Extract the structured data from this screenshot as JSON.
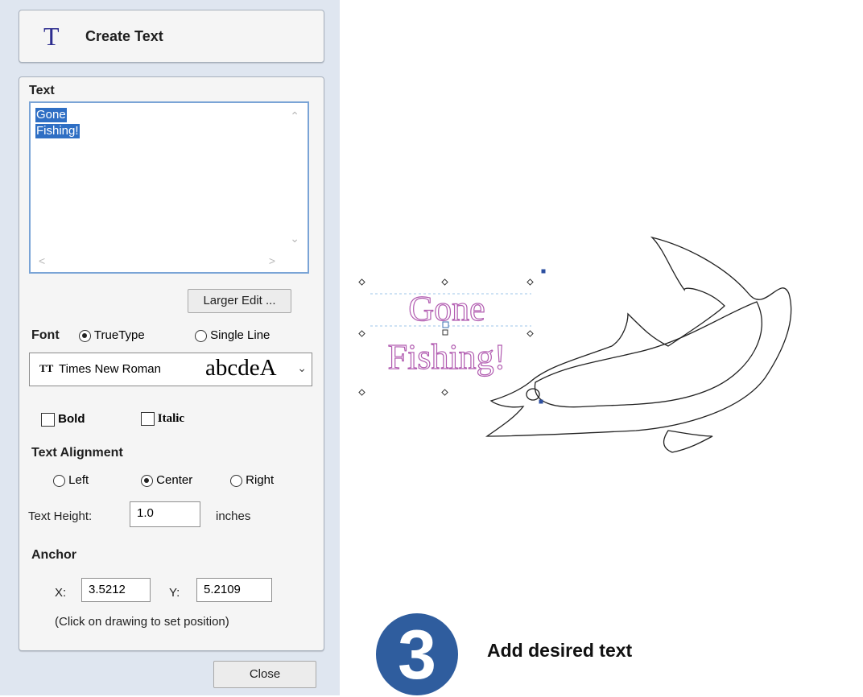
{
  "header": {
    "icon": "text-T-icon",
    "title": "Create Text"
  },
  "text_section": {
    "label": "Text",
    "lines": [
      "Gone",
      "Fishing!"
    ],
    "scroll_up": "^",
    "scroll_down": "v",
    "scroll_left": "<",
    "scroll_right": ">"
  },
  "larger_edit_label": "Larger Edit ...",
  "font": {
    "label": "Font",
    "truetype_label": "TrueType",
    "single_line_label": "Single Line",
    "selected_font": "Times New Roman",
    "preview": "abcdeA"
  },
  "style": {
    "bold_label": "Bold",
    "italic_label": "Italic"
  },
  "alignment": {
    "label": "Text Alignment",
    "left_label": "Left",
    "center_label": "Center",
    "right_label": "Right",
    "selected": "Center"
  },
  "height": {
    "label": "Text Height:",
    "value": "1.0",
    "unit": "inches"
  },
  "anchor": {
    "label": "Anchor",
    "x_label": "X:",
    "x_value": "3.5212",
    "y_label": "Y:",
    "y_value": "5.2109",
    "hint": "(Click on drawing to set position)"
  },
  "close_label": "Close",
  "canvas": {
    "line1": "Gone",
    "line2": "Fishing!",
    "text_color": "#b15bb0"
  },
  "step": {
    "number": "3",
    "caption": "Add desired text",
    "badge_color": "#2f5d9e"
  }
}
